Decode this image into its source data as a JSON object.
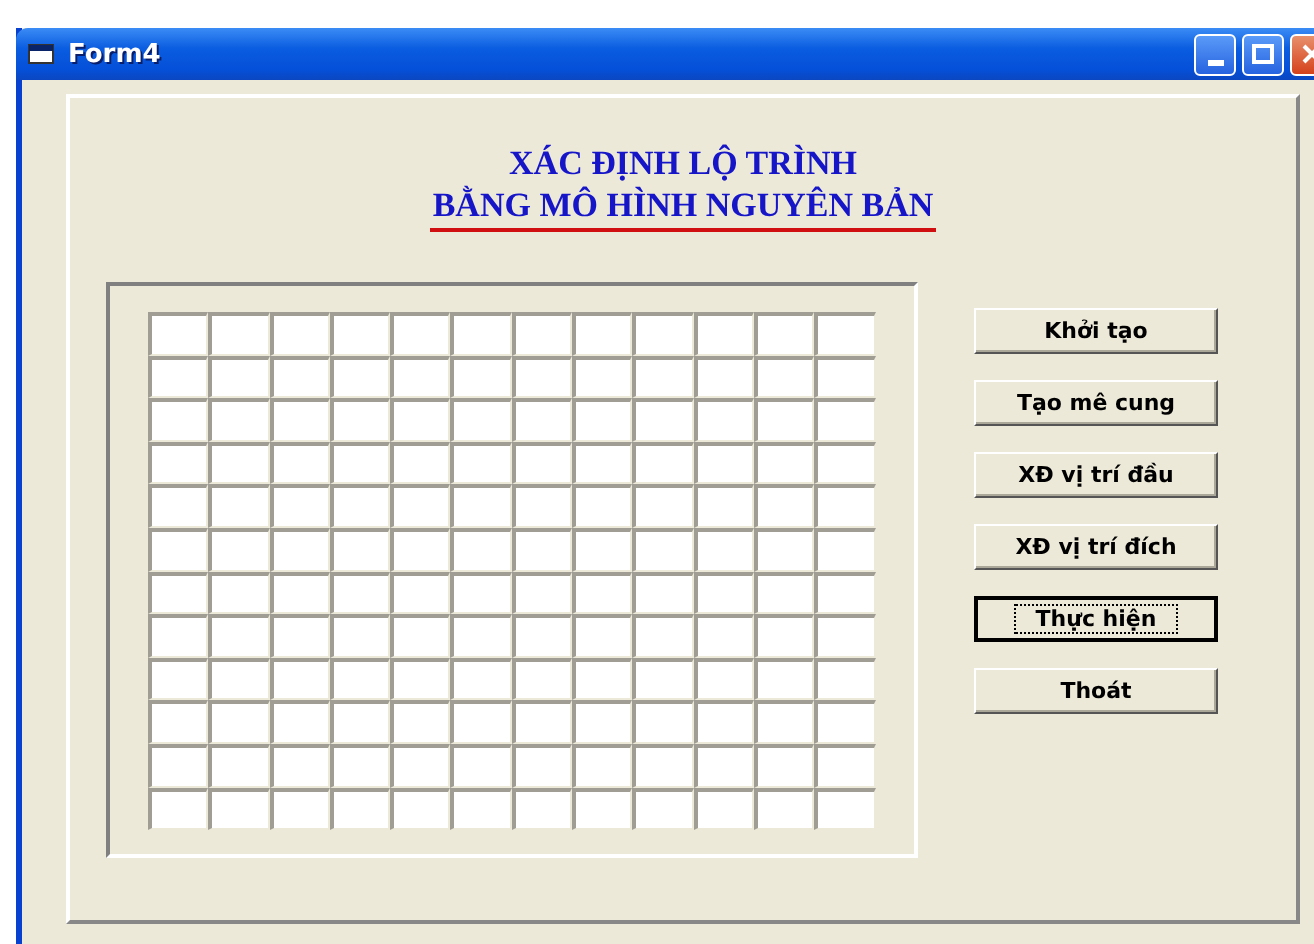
{
  "window": {
    "title": "Form4"
  },
  "heading": {
    "line_1": "XÁC ĐỊNH LỘ TRÌNH",
    "line_2": "BẰNG MÔ HÌNH NGUYÊN BẢN"
  },
  "maze": {
    "rows": [
      [
        false,
        false,
        false,
        false,
        false,
        false,
        false,
        false,
        false,
        false,
        false,
        false
      ],
      [
        false,
        false,
        false,
        false,
        false,
        false,
        false,
        false,
        false,
        false,
        false,
        false
      ],
      [
        false,
        false,
        false,
        false,
        false,
        false,
        false,
        false,
        false,
        false,
        false,
        false
      ],
      [
        false,
        false,
        false,
        false,
        false,
        false,
        false,
        false,
        false,
        false,
        false,
        false
      ],
      [
        false,
        false,
        false,
        false,
        false,
        false,
        false,
        false,
        false,
        false,
        false,
        false
      ],
      [
        false,
        false,
        false,
        false,
        false,
        false,
        false,
        false,
        false,
        false,
        false,
        false
      ],
      [
        false,
        false,
        false,
        false,
        false,
        false,
        false,
        false,
        false,
        false,
        false,
        false
      ],
      [
        false,
        false,
        false,
        false,
        false,
        false,
        false,
        false,
        false,
        false,
        false,
        false
      ],
      [
        false,
        false,
        false,
        false,
        false,
        false,
        false,
        false,
        false,
        false,
        false,
        false
      ],
      [
        false,
        false,
        false,
        false,
        false,
        false,
        false,
        false,
        false,
        false,
        false,
        false
      ],
      [
        false,
        false,
        false,
        false,
        false,
        false,
        false,
        false,
        false,
        false,
        false,
        false
      ],
      [
        false,
        false,
        false,
        false,
        false,
        false,
        false,
        false,
        false,
        false,
        false,
        false
      ]
    ]
  },
  "buttons": [
    {
      "label": "Khởi tạo",
      "focused": false
    },
    {
      "label": "Tạo mê cung",
      "focused": false
    },
    {
      "label": "XĐ vị trí đầu",
      "focused": false
    },
    {
      "label": "XĐ vị trí đích",
      "focused": false
    },
    {
      "label": "Thực hiện",
      "focused": true
    },
    {
      "label": "Thoát",
      "focused": false
    }
  ]
}
